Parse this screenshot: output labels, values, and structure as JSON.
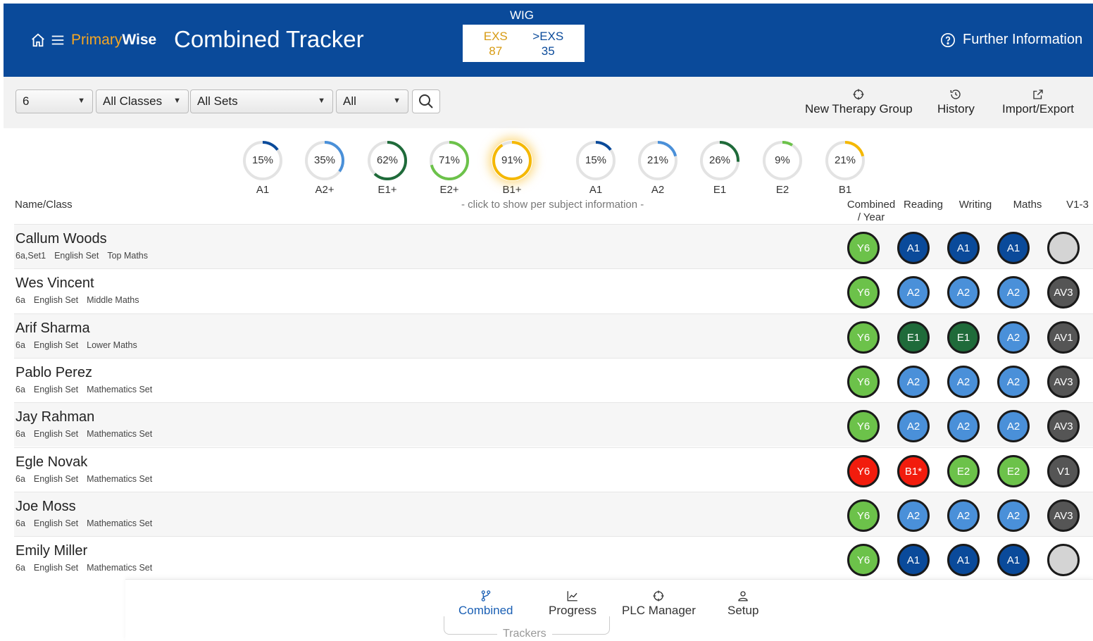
{
  "header": {
    "brand_part1": "Primary",
    "brand_part2": "Wise",
    "title": "Combined Tracker",
    "wig": {
      "label": "WIG",
      "exs_label": "EXS",
      "exs_value": "87",
      "gexs_label": ">EXS",
      "gexs_value": "35"
    },
    "further_info": "Further Information",
    "colors": {
      "bar": "#0a4a9a",
      "brand_accent": "#f5a623"
    }
  },
  "toolbar": {
    "year": "6",
    "classes": "All Classes",
    "sets": "All Sets",
    "filter": "All",
    "actions": [
      {
        "label": "New Therapy Group",
        "icon": "crosshair-icon"
      },
      {
        "label": "History",
        "icon": "history-icon"
      },
      {
        "label": "Import/Export",
        "icon": "share-icon"
      }
    ]
  },
  "gauges": [
    {
      "pct_label": "15%",
      "value": 15,
      "label": "A1",
      "color": "#0a4a9a"
    },
    {
      "pct_label": "35%",
      "value": 35,
      "label": "A2+",
      "color": "#4a90d9"
    },
    {
      "pct_label": "62%",
      "value": 62,
      "label": "E1+",
      "color": "#1f6b3a"
    },
    {
      "pct_label": "71%",
      "value": 71,
      "label": "E2+",
      "color": "#6cc24a"
    },
    {
      "pct_label": "91%",
      "value": 91,
      "label": "B1+",
      "color": "#f5b800",
      "highlight": true
    },
    {
      "pct_label": "15%",
      "value": 15,
      "label": "A1",
      "color": "#0a4a9a"
    },
    {
      "pct_label": "21%",
      "value": 21,
      "label": "A2",
      "color": "#4a90d9"
    },
    {
      "pct_label": "26%",
      "value": 26,
      "label": "E1",
      "color": "#1f6b3a"
    },
    {
      "pct_label": "9%",
      "value": 9,
      "label": "E2",
      "color": "#6cc24a"
    },
    {
      "pct_label": "21%",
      "value": 21,
      "label": "B1",
      "color": "#f5b800"
    }
  ],
  "gauge_hint": "- click to show per subject information -",
  "columns": {
    "name_class": "Name/Class",
    "combined_1": "Combined",
    "combined_2": "/ Year",
    "reading": "Reading",
    "writing": "Writing",
    "maths": "Maths",
    "v13": "V1-3"
  },
  "badge_colors": {
    "Y6": "#6cc24a",
    "Y6R": "#f21c0d",
    "A1": "#0a4a9a",
    "A2": "#4a90d9",
    "E1": "#1f6b3a",
    "E2": "#6cc24a",
    "B1*": "#f21c0d",
    "AV": "#555555",
    "empty": "#d4d4d4"
  },
  "students": [
    {
      "name": "Callum Woods",
      "meta": [
        "6a,Set1",
        "English Set",
        "Top Maths"
      ],
      "combined": "Y6",
      "combined_color": "#6cc24a",
      "reading": "A1",
      "reading_color": "#0a4a9a",
      "writing": "A1",
      "writing_color": "#0a4a9a",
      "maths": "A1",
      "maths_color": "#0a4a9a",
      "v": "",
      "v_color": "#d4d4d4"
    },
    {
      "name": "Wes Vincent",
      "meta": [
        "6a",
        "English Set",
        "Middle Maths"
      ],
      "combined": "Y6",
      "combined_color": "#6cc24a",
      "reading": "A2",
      "reading_color": "#4a90d9",
      "writing": "A2",
      "writing_color": "#4a90d9",
      "maths": "A2",
      "maths_color": "#4a90d9",
      "v": "AV3",
      "v_color": "#555555"
    },
    {
      "name": "Arif Sharma",
      "meta": [
        "6a",
        "English Set",
        "Lower Maths"
      ],
      "combined": "Y6",
      "combined_color": "#6cc24a",
      "reading": "E1",
      "reading_color": "#1f6b3a",
      "writing": "E1",
      "writing_color": "#1f6b3a",
      "maths": "A2",
      "maths_color": "#4a90d9",
      "v": "AV1",
      "v_color": "#555555"
    },
    {
      "name": "Pablo Perez",
      "meta": [
        "6a",
        "English Set",
        "Mathematics Set"
      ],
      "combined": "Y6",
      "combined_color": "#6cc24a",
      "reading": "A2",
      "reading_color": "#4a90d9",
      "writing": "A2",
      "writing_color": "#4a90d9",
      "maths": "A2",
      "maths_color": "#4a90d9",
      "v": "AV3",
      "v_color": "#555555"
    },
    {
      "name": "Jay Rahman",
      "meta": [
        "6a",
        "English Set",
        "Mathematics Set"
      ],
      "combined": "Y6",
      "combined_color": "#6cc24a",
      "reading": "A2",
      "reading_color": "#4a90d9",
      "writing": "A2",
      "writing_color": "#4a90d9",
      "maths": "A2",
      "maths_color": "#4a90d9",
      "v": "AV3",
      "v_color": "#555555"
    },
    {
      "name": "Egle Novak",
      "meta": [
        "6a",
        "English Set",
        "Mathematics Set"
      ],
      "combined": "Y6",
      "combined_color": "#f21c0d",
      "reading": "B1*",
      "reading_color": "#f21c0d",
      "writing": "E2",
      "writing_color": "#6cc24a",
      "maths": "E2",
      "maths_color": "#6cc24a",
      "v": "V1",
      "v_color": "#555555"
    },
    {
      "name": "Joe Moss",
      "meta": [
        "6a",
        "English Set",
        "Mathematics Set"
      ],
      "combined": "Y6",
      "combined_color": "#6cc24a",
      "reading": "A2",
      "reading_color": "#4a90d9",
      "writing": "A2",
      "writing_color": "#4a90d9",
      "maths": "A2",
      "maths_color": "#4a90d9",
      "v": "AV3",
      "v_color": "#555555"
    },
    {
      "name": "Emily Miller",
      "meta": [
        "6a",
        "English Set",
        "Mathematics Set"
      ],
      "combined": "Y6",
      "combined_color": "#6cc24a",
      "reading": "A1",
      "reading_color": "#0a4a9a",
      "writing": "A1",
      "writing_color": "#0a4a9a",
      "maths": "A1",
      "maths_color": "#0a4a9a",
      "v": "",
      "v_color": "#d4d4d4"
    }
  ],
  "bottom_nav": {
    "items": [
      {
        "label": "Combined",
        "icon": "branch-icon",
        "active": true
      },
      {
        "label": "Progress",
        "icon": "chart-icon",
        "active": false
      },
      {
        "label": "PLC Manager",
        "icon": "crosshair-icon",
        "active": false
      },
      {
        "label": "Setup",
        "icon": "user-icon",
        "active": false
      }
    ],
    "group_label": "Trackers"
  }
}
